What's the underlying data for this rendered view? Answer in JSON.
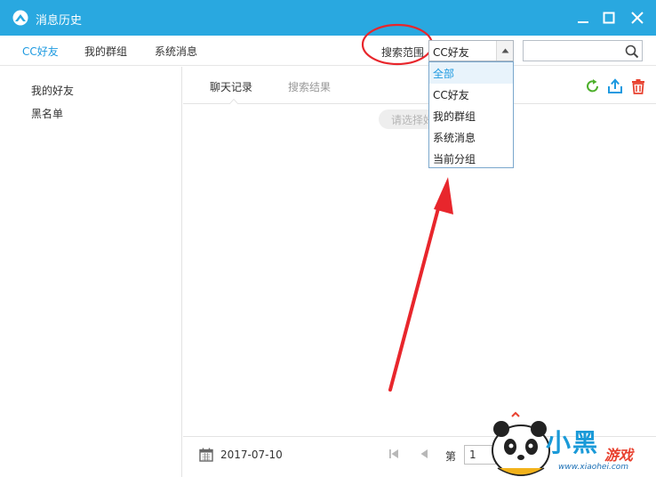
{
  "window": {
    "title": "消息历史",
    "logo_icon": "cloud-logo-icon",
    "controls": [
      "minimize-icon",
      "maximize-icon",
      "close-icon"
    ]
  },
  "colors": {
    "titlebar": "#29a8e0",
    "accent": "#1e9ae0",
    "annotation": "#e8262c"
  },
  "topnav": {
    "tabs": [
      {
        "label": "CC好友",
        "active": true
      },
      {
        "label": "我的群组",
        "active": false
      },
      {
        "label": "系统消息",
        "active": false
      }
    ],
    "scope_label": "搜索范围",
    "scope_value": "CC好友",
    "search_placeholder": ""
  },
  "dropdown": {
    "options": [
      "全部",
      "CC好友",
      "我的群组",
      "系统消息",
      "当前分组"
    ],
    "highlighted": "全部"
  },
  "sidebar": {
    "items": [
      "我的好友",
      "黑名单"
    ]
  },
  "content": {
    "tabs": [
      {
        "label": "聊天记录",
        "active": true
      },
      {
        "label": "搜索结果",
        "active": false
      }
    ],
    "actions": [
      "refresh-icon",
      "export-icon",
      "delete-icon"
    ],
    "hint": "请选择好友"
  },
  "footer": {
    "date": "2017-07-10",
    "page_label": "第",
    "page_value": "1"
  },
  "watermark": {
    "brand": "小黑",
    "sub": "游戏",
    "url": "www.xiaohei.com"
  }
}
